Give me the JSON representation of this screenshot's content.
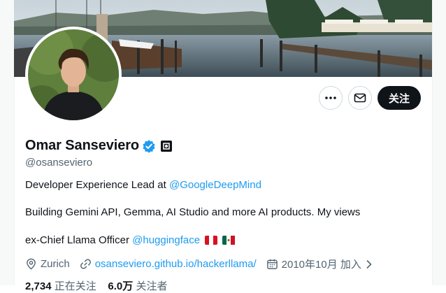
{
  "profile": {
    "name": "Omar Sanseviero",
    "handle": "@osanseviero",
    "verified_color": "#1d9bf0"
  },
  "actions": {
    "more_icon": "more-horizontal-icon",
    "message_icon": "envelope-icon",
    "follow_label": "关注"
  },
  "bio": {
    "line1_text": "Developer Experience Lead at ",
    "line1_link": "@GoogleDeepMind",
    "line2_text": "Building Gemini API, Gemma, AI Studio and more AI products. My views",
    "line3_text": "ex-Chief Llama Officer ",
    "line3_link": "@huggingface",
    "flags": [
      "Peru",
      "Mexico"
    ]
  },
  "meta": {
    "location": "Zurich",
    "website": "osanseviero.github.io/hackerllama/",
    "joined": "2010年10月 加入"
  },
  "counts": {
    "following_value": "2,734",
    "following_label": "正在关注",
    "followers_value": "6.0万",
    "followers_label": "关注者"
  },
  "colors": {
    "accent": "#1d9bf0",
    "text": "#0f1419",
    "secondary": "#536471",
    "follow_button": "#0f1419"
  }
}
